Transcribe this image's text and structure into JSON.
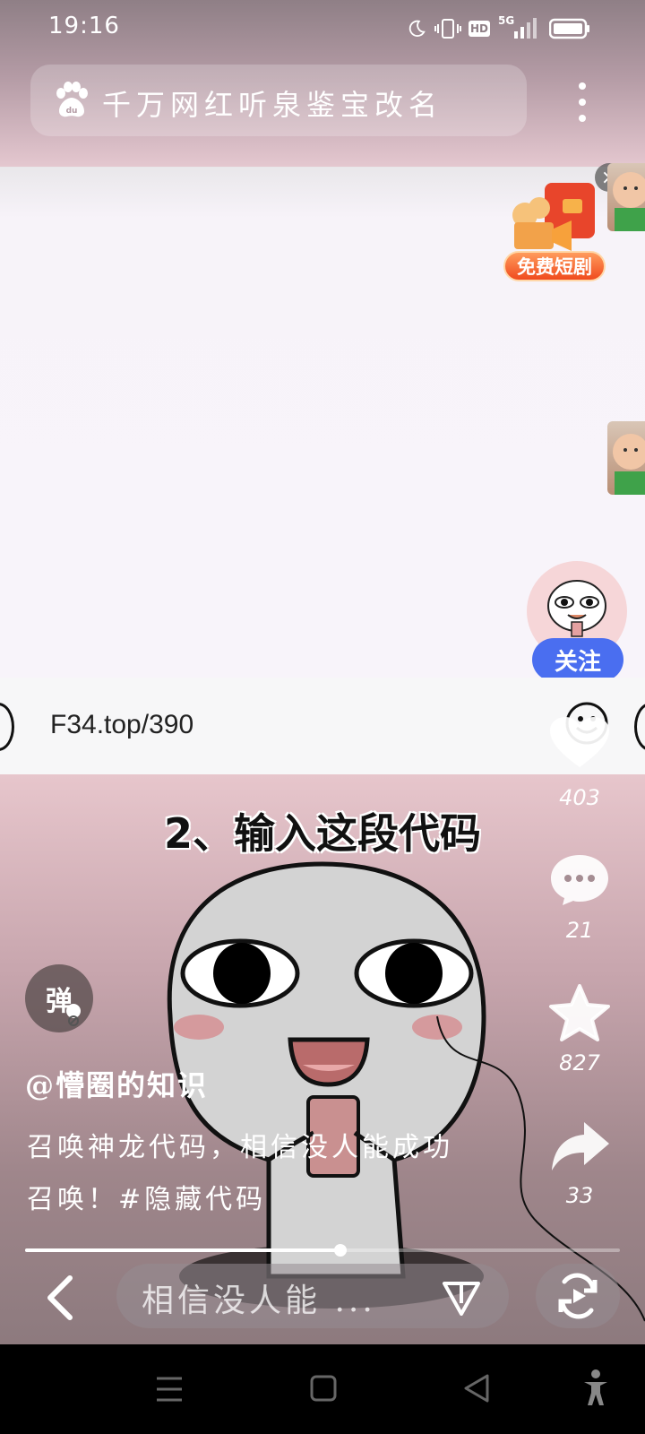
{
  "status_bar": {
    "time": "19:16",
    "icons": [
      "moon-icon",
      "vibrate-icon",
      "hd-icon",
      "5g-signal-icon",
      "battery-icon"
    ],
    "hd_label": "HD",
    "network_label": "5G"
  },
  "search": {
    "logo_icon": "baidu-paw-icon",
    "query": "千万网红听泉鉴宝改名",
    "menu_icon": "more-vertical-icon"
  },
  "ad": {
    "label": "免费短剧",
    "close_icon": "close-icon"
  },
  "creator": {
    "follow_label": "关注",
    "handle": "@懵圈的知识"
  },
  "url_bar": {
    "url": "F34.top/390"
  },
  "video": {
    "overlay_text": "2、输入这段代码",
    "danmu_label": "弹",
    "description": "召唤神龙代码，相信没人能成功召唤！#隐藏代码",
    "progress_percent": 53
  },
  "actions": {
    "like_count": "403",
    "comment_count": "21",
    "favorite_count": "827",
    "share_count": "33"
  },
  "bottom_bar": {
    "comment_placeholder": "相信没人能 ...",
    "icons": [
      "back-icon",
      "send-icon",
      "replay-icon"
    ]
  },
  "nav_bar": {
    "icons": [
      "menu-icon",
      "home-icon",
      "back-triangle-icon",
      "accessibility-icon"
    ]
  },
  "colors": {
    "follow_button": "#4a6ef0",
    "ad_label": "#f04b1e",
    "nav_bar": "#000000"
  }
}
